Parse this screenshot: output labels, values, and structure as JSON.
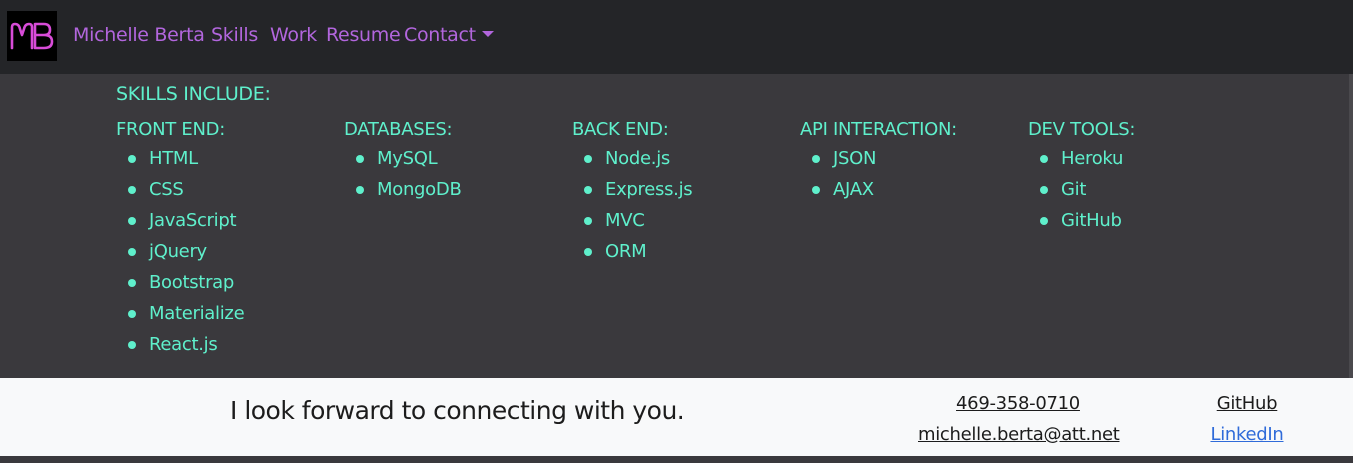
{
  "nav": {
    "logo_text": "MB",
    "brand": "Michelle Berta",
    "links": [
      "Skills",
      "Work",
      "Resume",
      "Contact"
    ]
  },
  "skills": {
    "heading": "SKILLS INCLUDE:",
    "columns": [
      {
        "title": "FRONT END:",
        "items": [
          "HTML",
          "CSS",
          "JavaScript",
          "jQuery",
          "Bootstrap",
          "Materialize",
          "React.js"
        ]
      },
      {
        "title": "DATABASES:",
        "items": [
          "MySQL",
          "MongoDB"
        ]
      },
      {
        "title": "BACK END:",
        "items": [
          "Node.js",
          "Express.js",
          "MVC",
          "ORM"
        ]
      },
      {
        "title": "API INTERACTION:",
        "items": [
          "JSON",
          "AJAX"
        ]
      },
      {
        "title": "DEV TOOLS:",
        "items": [
          "Heroku",
          "Git",
          "GitHub"
        ]
      }
    ]
  },
  "footer": {
    "tagline": "I look forward to connecting with you.",
    "phone": "469-358-0710",
    "email": "michelle.berta@att.net",
    "github": "GitHub",
    "linkedin": "LinkedIn"
  },
  "colors": {
    "accent": "#b266dd",
    "skills_text": "#5ff0cc",
    "link_blue": "#2f6bd9"
  }
}
